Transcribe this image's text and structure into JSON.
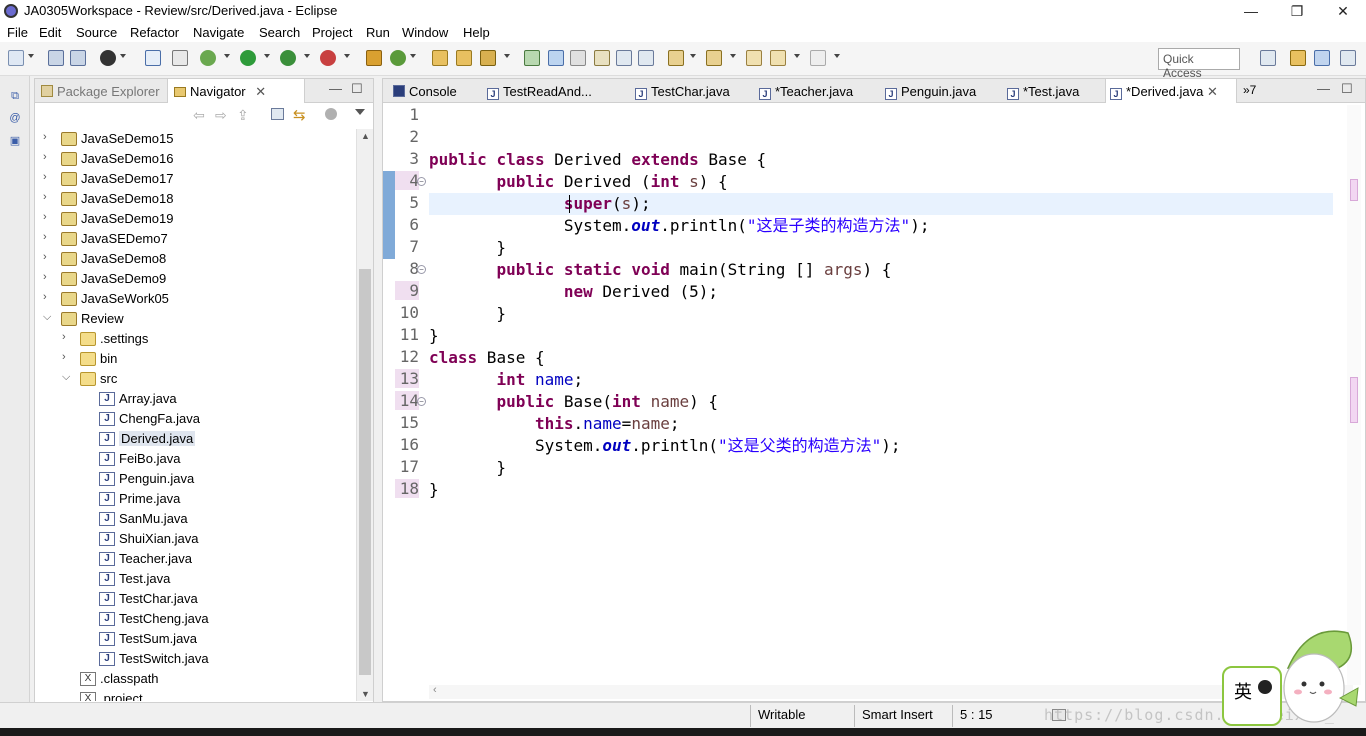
{
  "window": {
    "title": "JA0305Workspace - Review/src/Derived.java - Eclipse"
  },
  "menu": [
    "File",
    "Edit",
    "Source",
    "Refactor",
    "Navigate",
    "Search",
    "Project",
    "Run",
    "Window",
    "Help"
  ],
  "toolbar": {
    "quick_access": "Quick Access"
  },
  "left_panel": {
    "tabs": [
      "Package Explorer",
      "Navigator"
    ],
    "active_tab": "Navigator",
    "tree": [
      {
        "label": "JavaSeDemo15",
        "level": 0,
        "type": "project",
        "expanded": false
      },
      {
        "label": "JavaSeDemo16",
        "level": 0,
        "type": "project",
        "expanded": false
      },
      {
        "label": "JavaSeDemo17",
        "level": 0,
        "type": "project",
        "expanded": false
      },
      {
        "label": "JavaSeDemo18",
        "level": 0,
        "type": "project",
        "expanded": false
      },
      {
        "label": "JavaSeDemo19",
        "level": 0,
        "type": "project",
        "expanded": false
      },
      {
        "label": "JavaSEDemo7",
        "level": 0,
        "type": "project",
        "expanded": false
      },
      {
        "label": "JavaSeDemo8",
        "level": 0,
        "type": "project",
        "expanded": false
      },
      {
        "label": "JavaSeDemo9",
        "level": 0,
        "type": "project",
        "expanded": false
      },
      {
        "label": "JavaSeWork05",
        "level": 0,
        "type": "project",
        "expanded": false
      },
      {
        "label": "Review",
        "level": 0,
        "type": "project",
        "expanded": true
      },
      {
        "label": ".settings",
        "level": 1,
        "type": "folder",
        "expanded": false
      },
      {
        "label": "bin",
        "level": 1,
        "type": "folder",
        "expanded": false
      },
      {
        "label": "src",
        "level": 1,
        "type": "folder",
        "expanded": true
      },
      {
        "label": "Array.java",
        "level": 2,
        "type": "java"
      },
      {
        "label": "ChengFa.java",
        "level": 2,
        "type": "java"
      },
      {
        "label": "Derived.java",
        "level": 2,
        "type": "java",
        "selected": true
      },
      {
        "label": "FeiBo.java",
        "level": 2,
        "type": "java"
      },
      {
        "label": "Penguin.java",
        "level": 2,
        "type": "java"
      },
      {
        "label": "Prime.java",
        "level": 2,
        "type": "java"
      },
      {
        "label": "SanMu.java",
        "level": 2,
        "type": "java"
      },
      {
        "label": "ShuiXian.java",
        "level": 2,
        "type": "java"
      },
      {
        "label": "Teacher.java",
        "level": 2,
        "type": "java"
      },
      {
        "label": "Test.java",
        "level": 2,
        "type": "java"
      },
      {
        "label": "TestChar.java",
        "level": 2,
        "type": "java"
      },
      {
        "label": "TestCheng.java",
        "level": 2,
        "type": "java"
      },
      {
        "label": "TestSum.java",
        "level": 2,
        "type": "java"
      },
      {
        "label": "TestSwitch.java",
        "level": 2,
        "type": "java"
      },
      {
        "label": ".classpath",
        "level": 1,
        "type": "xml"
      },
      {
        "label": ".project",
        "level": 1,
        "type": "xml"
      }
    ]
  },
  "editor": {
    "tabs": [
      "Console",
      "TestReadAnd...",
      "TestChar.java",
      "*Teacher.java",
      "Penguin.java",
      "*Test.java",
      "*Derived.java"
    ],
    "overflow": "»7",
    "active_tab": "*Derived.java",
    "lines": [
      [],
      [],
      [
        [
          "kw",
          "public"
        ],
        [
          "t",
          " "
        ],
        [
          "kw",
          "class"
        ],
        [
          "t",
          " Derived "
        ],
        [
          "kw",
          "extends"
        ],
        [
          "t",
          " Base {"
        ]
      ],
      [
        [
          "t",
          "       "
        ],
        [
          "kw",
          "public"
        ],
        [
          "t",
          " Derived ("
        ],
        [
          "kw",
          "int"
        ],
        [
          "t",
          " "
        ],
        [
          "par",
          "s"
        ],
        [
          "t",
          ") {"
        ]
      ],
      [
        [
          "t",
          "              "
        ],
        [
          "kw",
          "super"
        ],
        [
          "t",
          "("
        ],
        [
          "par",
          "s"
        ],
        [
          "t",
          ");"
        ]
      ],
      [
        [
          "t",
          "              System."
        ],
        [
          "st",
          "out"
        ],
        [
          "t",
          ".println("
        ],
        [
          "str",
          "\"这是子类的构造方法\""
        ],
        [
          "t",
          ");"
        ]
      ],
      [
        [
          "t",
          "       }"
        ]
      ],
      [
        [
          "t",
          "       "
        ],
        [
          "kw",
          "public"
        ],
        [
          "t",
          " "
        ],
        [
          "kw",
          "static"
        ],
        [
          "t",
          " "
        ],
        [
          "kw",
          "void"
        ],
        [
          "t",
          " main(String [] "
        ],
        [
          "par",
          "args"
        ],
        [
          "t",
          ") {"
        ]
      ],
      [
        [
          "t",
          "              "
        ],
        [
          "kw",
          "new"
        ],
        [
          "t",
          " Derived (5);"
        ]
      ],
      [
        [
          "t",
          "       }"
        ]
      ],
      [
        [
          "t",
          "}"
        ]
      ],
      [
        [
          "kw",
          "class"
        ],
        [
          "t",
          " Base {"
        ]
      ],
      [
        [
          "t",
          "       "
        ],
        [
          "kw",
          "int"
        ],
        [
          "t",
          " "
        ],
        [
          "fld",
          "name"
        ],
        [
          "t",
          ";"
        ]
      ],
      [
        [
          "t",
          "       "
        ],
        [
          "kw",
          "public"
        ],
        [
          "t",
          " Base("
        ],
        [
          "kw",
          "int"
        ],
        [
          "t",
          " "
        ],
        [
          "par",
          "name"
        ],
        [
          "t",
          ") {"
        ]
      ],
      [
        [
          "t",
          "           "
        ],
        [
          "kw",
          "this"
        ],
        [
          "t",
          "."
        ],
        [
          "fld",
          "name"
        ],
        [
          "t",
          "="
        ],
        [
          "par",
          "name"
        ],
        [
          "t",
          ";"
        ]
      ],
      [
        [
          "t",
          "           System."
        ],
        [
          "st",
          "out"
        ],
        [
          "t",
          ".println("
        ],
        [
          "str",
          "\"这是父类的构造方法\""
        ],
        [
          "t",
          ");"
        ]
      ],
      [
        [
          "t",
          "       }"
        ]
      ],
      [
        [
          "t",
          "}"
        ]
      ]
    ],
    "line_numbers": [
      "1",
      "2",
      "3",
      "4",
      "5",
      "6",
      "7",
      "8",
      "9",
      "10",
      "11",
      "12",
      "13",
      "14",
      "15",
      "16",
      "17",
      "18"
    ],
    "highlighted_line_numbers": [
      4,
      9,
      13,
      14,
      18
    ],
    "current_line": 5
  },
  "status": {
    "writable": "Writable",
    "insert_mode": "Smart Insert",
    "position": "5 : 15"
  },
  "watermark": "https://blog.csdn.net/weixin_",
  "ime": {
    "label": "英"
  }
}
